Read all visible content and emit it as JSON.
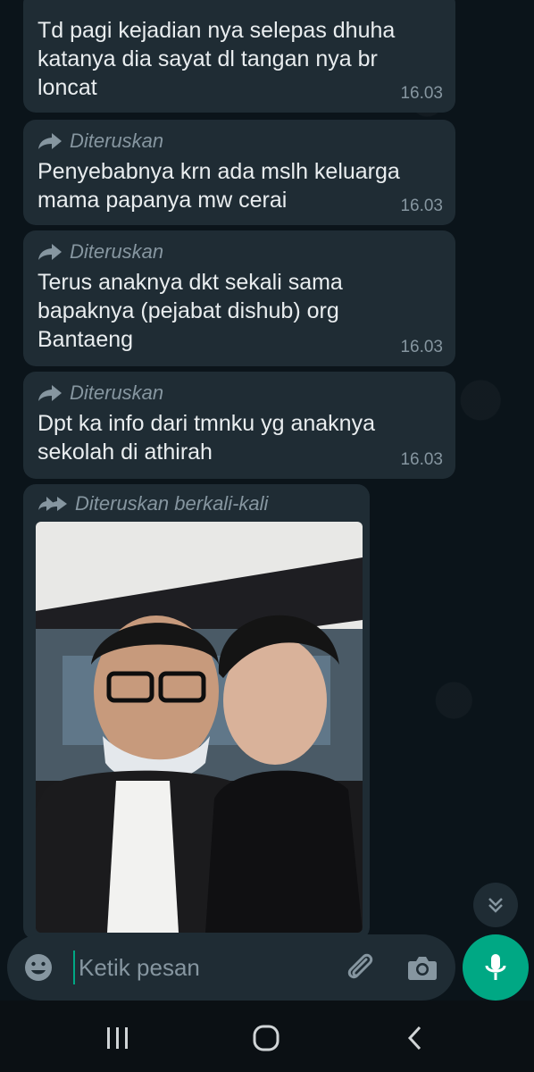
{
  "messages": [
    {
      "forwarded_label": "",
      "text": "Td pagi kejadian nya selepas dhuha katanya dia sayat dl tangan nya br loncat",
      "time": "16.03"
    },
    {
      "forwarded_label": "Diteruskan",
      "text": "Penyebabnya krn ada mslh keluarga mama papanya mw cerai",
      "time": "16.03"
    },
    {
      "forwarded_label": "Diteruskan",
      "text": "Terus anaknya dkt sekali sama bapaknya (pejabat dishub) org Bantaeng",
      "time": "16.03"
    },
    {
      "forwarded_label": "Diteruskan",
      "text": "Dpt ka info dari tmnku yg anaknya sekolah di athirah",
      "time": "16.03"
    }
  ],
  "photo_message": {
    "forwarded_label": "Diteruskan berkali-kali"
  },
  "composer": {
    "placeholder": "Ketik pesan"
  },
  "colors": {
    "accent": "#00a884",
    "bubble": "#1f2c34",
    "background": "#0b141a",
    "meta_text": "#8696a0"
  },
  "icons": {
    "forward": "forward-arrow-icon",
    "forward_many": "double-forward-arrow-icon",
    "emoji": "emoji-icon",
    "attach": "paperclip-icon",
    "camera": "camera-icon",
    "mic": "microphone-icon",
    "scroll": "chevron-double-down-icon",
    "nav_recent": "recent-apps-icon",
    "nav_home": "home-icon",
    "nav_back": "back-icon"
  }
}
